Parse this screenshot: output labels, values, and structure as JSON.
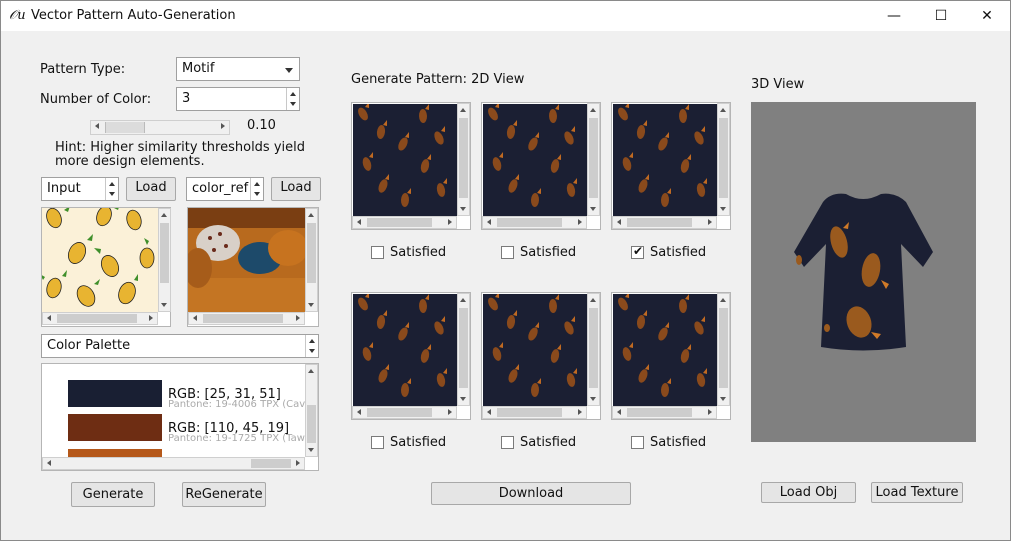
{
  "window": {
    "title": "Vector Pattern Auto-Generation",
    "icon": "app-script-icon",
    "controls": {
      "minimize": "—",
      "maximize": "☐",
      "close": "✕"
    }
  },
  "left": {
    "pattern_type_label": "Pattern Type:",
    "pattern_type_value": "Motif",
    "num_color_label": "Number of Color:",
    "num_color_value": "3",
    "slider_value": "0.10",
    "slider_fraction": 0.1,
    "hint": "Hint: Higher similarity thresholds yield more design elements.",
    "input_spin_value": "Input",
    "color_ref_spin_value": "color_ref",
    "load_label": "Load",
    "palette_select_value": "Color Palette",
    "palette": [
      {
        "rgb": "RGB: [25, 31, 51]",
        "pantone": "Pantone: 19-4006 TPX (Cavi",
        "color": "#191f33"
      },
      {
        "rgb": "RGB: [110, 45, 19]",
        "pantone": "Pantone: 19-1725 TPX (Tawn",
        "color": "#6e2d13"
      },
      {
        "rgb": "",
        "pantone": "",
        "color": "#b5581a"
      }
    ],
    "generate_label": "Generate",
    "regenerate_label": "ReGenerate"
  },
  "middle": {
    "title": "Generate Pattern: 2D View",
    "satisfied_label": "Satisfied",
    "patterns": [
      {
        "checked": false
      },
      {
        "checked": false
      },
      {
        "checked": true
      },
      {
        "checked": false
      },
      {
        "checked": false
      },
      {
        "checked": false
      }
    ],
    "download_label": "Download"
  },
  "right": {
    "title": "3D View",
    "load_obj_label": "Load Obj",
    "load_texture_label": "Load Texture"
  },
  "colors": {
    "pattern_bg": "#1b1f33",
    "motif_brown": "#8a4a1c",
    "motif_orange": "#c06a22",
    "viewport_bg": "#808080"
  }
}
